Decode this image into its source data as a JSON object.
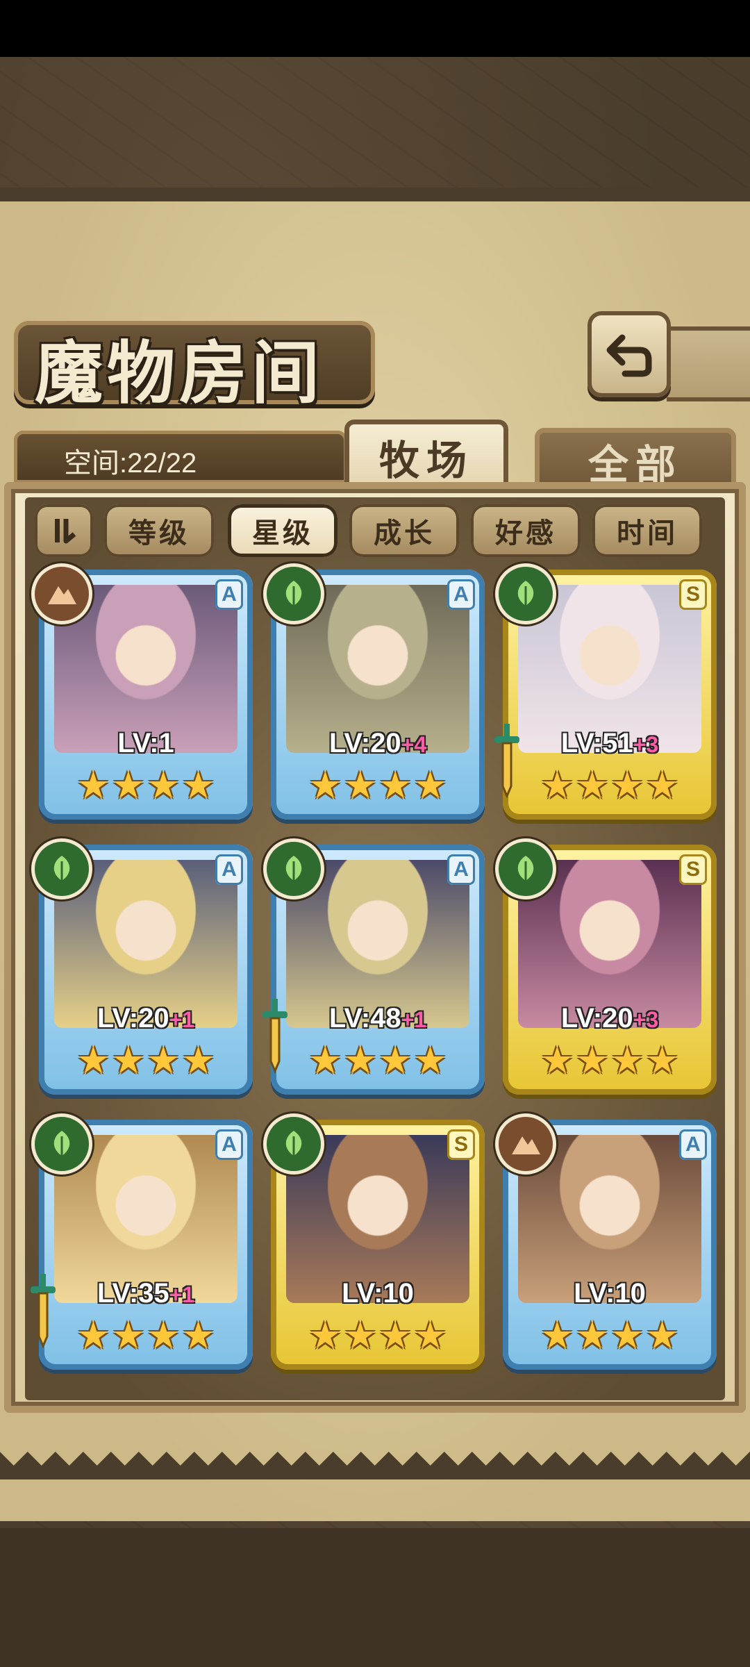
{
  "header": {
    "title": "魔物房间"
  },
  "capacity": {
    "text": "空间:22/22"
  },
  "tabs": [
    {
      "label": "牧场",
      "active": true
    },
    {
      "label": "全部",
      "active": false
    }
  ],
  "sort": {
    "toggle_icon": "sort-order-icon",
    "buttons": [
      {
        "label": "等级",
        "active": false
      },
      {
        "label": "星级",
        "active": true
      },
      {
        "label": "成长",
        "active": false
      },
      {
        "label": "好感",
        "active": false
      },
      {
        "label": "时间",
        "active": false
      }
    ]
  },
  "colors": {
    "rank_A": "#3f7fb0",
    "rank_S": "#a8861a",
    "star": "#ffc83a",
    "plus": "#ff5ca8",
    "element_leaf": "#2f6a2f",
    "element_earth": "#7a4d2e"
  },
  "monsters": [
    {
      "rank": "A",
      "element": "earth",
      "level": "LV:1",
      "plus": "",
      "stars": 4,
      "weapon": false
    },
    {
      "rank": "A",
      "element": "leaf",
      "level": "LV:20",
      "plus": "+4",
      "stars": 4,
      "weapon": false
    },
    {
      "rank": "S",
      "element": "leaf",
      "level": "LV:51",
      "plus": "+3",
      "stars": 4,
      "weapon": true
    },
    {
      "rank": "A",
      "element": "leaf",
      "level": "LV:20",
      "plus": "+1",
      "stars": 4,
      "weapon": false
    },
    {
      "rank": "A",
      "element": "leaf",
      "level": "LV:48",
      "plus": "+1",
      "stars": 4,
      "weapon": true
    },
    {
      "rank": "S",
      "element": "leaf",
      "level": "LV:20",
      "plus": "+3",
      "stars": 4,
      "weapon": false
    },
    {
      "rank": "A",
      "element": "leaf",
      "level": "LV:35",
      "plus": "+1",
      "stars": 4,
      "weapon": true
    },
    {
      "rank": "S",
      "element": "leaf",
      "level": "LV:10",
      "plus": "",
      "stars": 4,
      "weapon": false
    },
    {
      "rank": "A",
      "element": "earth",
      "level": "LV:10",
      "plus": "",
      "stars": 4,
      "weapon": false
    }
  ]
}
